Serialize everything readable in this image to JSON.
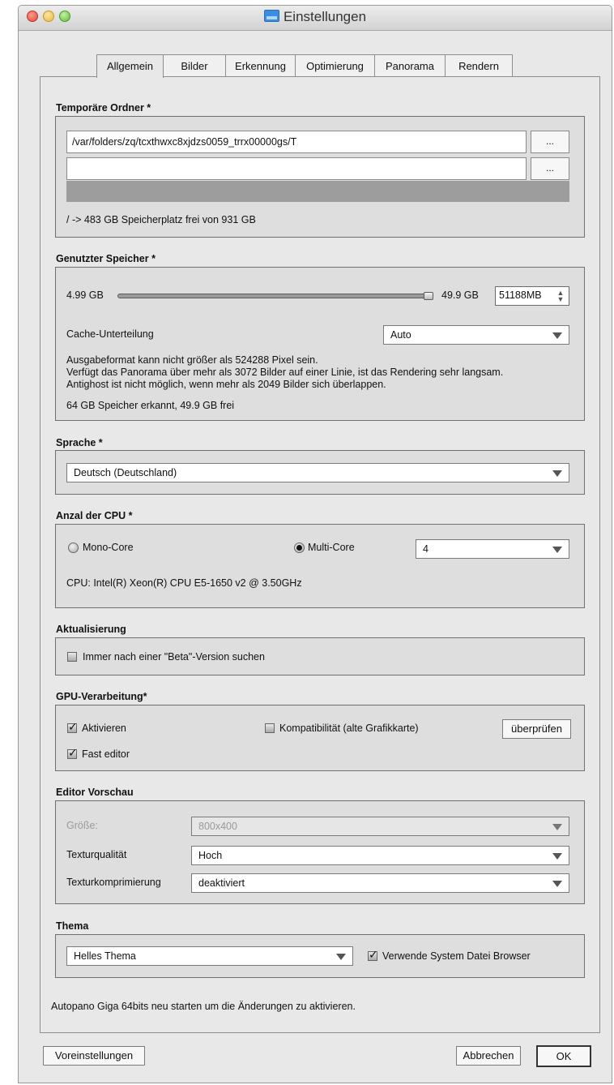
{
  "window": {
    "title": "Einstellungen"
  },
  "tabs": [
    "Allgemein",
    "Bilder",
    "Erkennung",
    "Optimierung",
    "Panorama",
    "Rendern"
  ],
  "temp_folders": {
    "title": "Temporäre Ordner *",
    "path1": "/var/folders/zq/tcxthwxc8xjdzs0059_trrx00000gs/T",
    "path2": "",
    "browse_label": "...",
    "free_space": "/ -> 483 GB Speicherplatz frei von 931 GB"
  },
  "memory": {
    "title": "Genutzter Speicher *",
    "min_label": "4.99 GB",
    "max_label": "49.9 GB",
    "stepper_value": "51188MB",
    "slider_fraction": 1.0,
    "cache_label": "Cache-Unterteilung",
    "cache_value": "Auto",
    "info1": "Ausgabeformat kann nicht größer als 524288 Pixel sein.",
    "info2": "Verfügt das Panorama über mehr als 3072 Bilder auf einer Linie, ist das Rendering sehr langsam.",
    "info3": "Antighost ist nicht möglich, wenn mehr als 2049 Bilder sich überlappen.",
    "detected": "64 GB Speicher erkannt, 49.9 GB frei"
  },
  "language": {
    "title": "Sprache *",
    "value": "Deutsch (Deutschland)"
  },
  "cpu": {
    "title": "Anzal der CPU *",
    "mono_label": "Mono-Core",
    "multi_label": "Multi-Core",
    "cores_value": "4",
    "cpu_info": "CPU:  Intel(R) Xeon(R) CPU E5-1650 v2 @ 3.50GHz"
  },
  "update": {
    "title": "Aktualisierung",
    "beta_label": "Immer nach einer \"Beta\"-Version suchen"
  },
  "gpu": {
    "title": "GPU-Verarbeitung*",
    "activate_label": "Aktivieren",
    "compat_label": "Kompatibilität (alte Grafikkarte)",
    "check_button": "überprüfen",
    "fast_editor_label": "Fast editor"
  },
  "preview": {
    "title": "Editor Vorschau",
    "size_label": "Größe:",
    "size_value": "800x400",
    "quality_label": "Texturqualität",
    "quality_value": "Hoch",
    "compression_label": "Texturkomprimierung",
    "compression_value": "deaktiviert"
  },
  "theme": {
    "title": "Thema",
    "value": "Helles Thema",
    "system_browser_label": "Verwende System Datei Browser"
  },
  "restart_note": "Autopano Giga 64bits neu starten um die Änderungen zu aktivieren.",
  "footer": {
    "defaults": "Voreinstellungen",
    "cancel": "Abbrechen",
    "ok": "OK"
  }
}
